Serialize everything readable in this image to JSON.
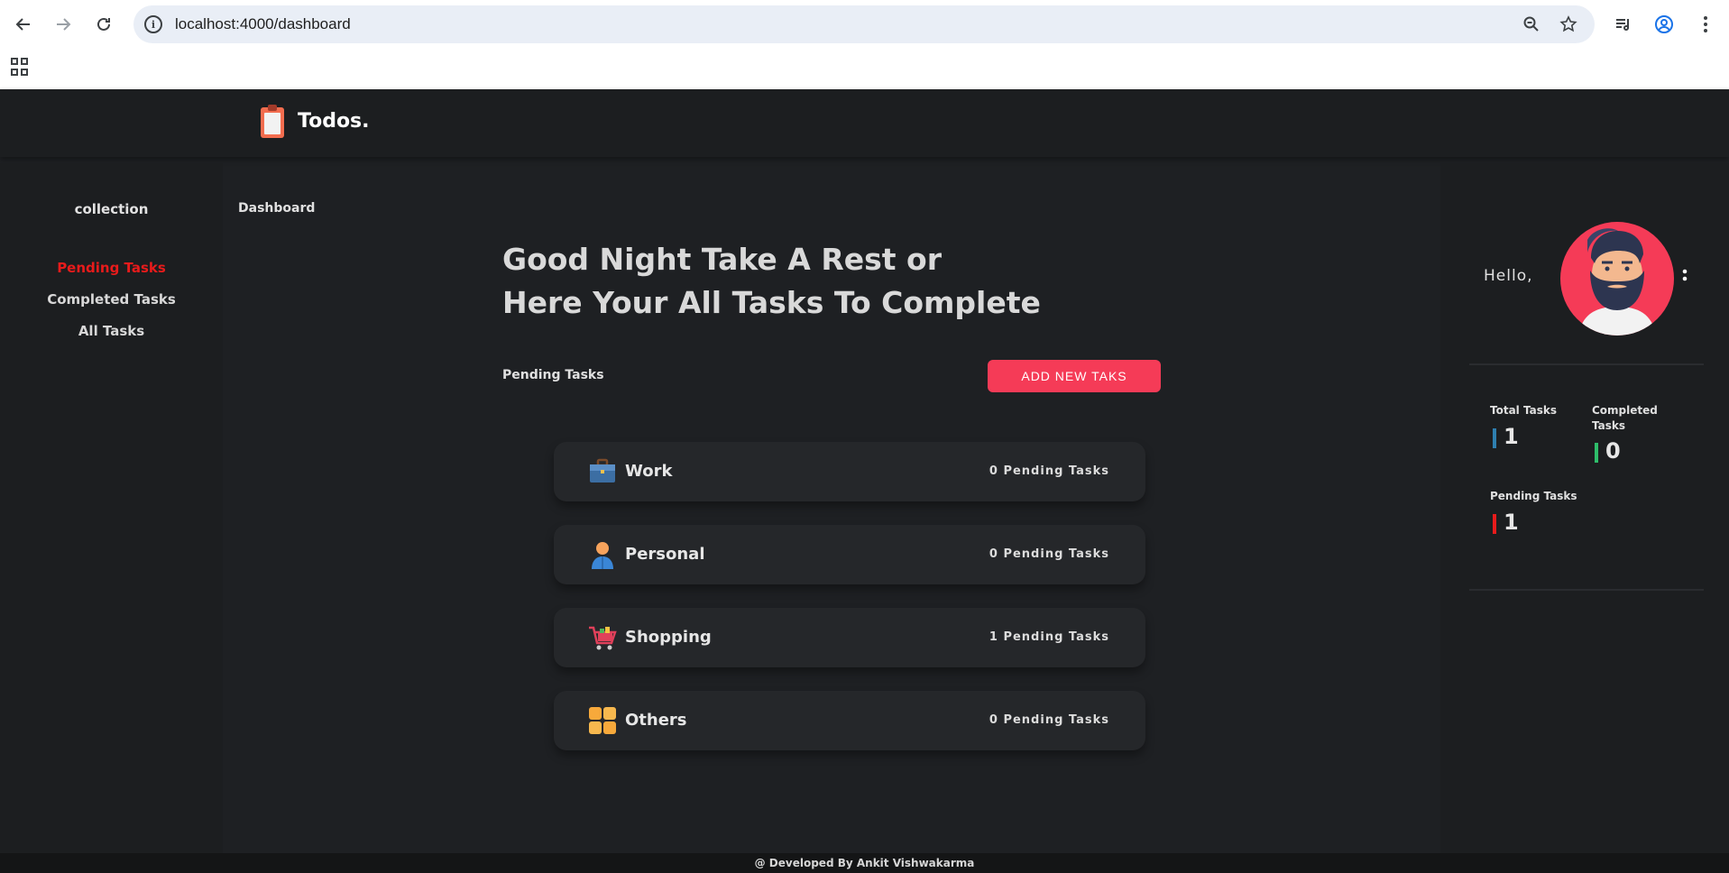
{
  "browser": {
    "url": "localhost:4000/dashboard",
    "back_icon": "arrow-left-icon",
    "forward_icon": "arrow-right-icon",
    "reload_icon": "reload-icon",
    "site_info_icon": "info-icon",
    "zoom_icon": "zoom-icon",
    "bookmark_icon": "star-icon",
    "reading_list_icon": "media-icon",
    "profile_icon": "profile-icon",
    "menu_icon": "kebab-icon",
    "apps_icon": "apps-grid-icon"
  },
  "header": {
    "brand": "Todos.",
    "logo_icon": "clipboard-icon"
  },
  "sidebar": {
    "title": "collection",
    "items": [
      {
        "label": "Pending Tasks",
        "active": true
      },
      {
        "label": "Completed Tasks",
        "active": false
      },
      {
        "label": "All Tasks",
        "active": false
      }
    ]
  },
  "main": {
    "breadcrumb": "Dashboard",
    "greeting_line1": "Good Night Take A Rest or",
    "greeting_line2": "Here Your All Tasks To Complete",
    "section_label": "Pending Tasks",
    "add_button": "ADD NEW TAKS",
    "categories": [
      {
        "name": "Work",
        "count_label": "0 Pending Tasks",
        "icon": "briefcase-icon"
      },
      {
        "name": "Personal",
        "count_label": "0 Pending Tasks",
        "icon": "person-icon"
      },
      {
        "name": "Shopping",
        "count_label": "1 Pending Tasks",
        "icon": "shopping-cart-icon"
      },
      {
        "name": "Others",
        "count_label": "0 Pending Tasks",
        "icon": "grid-icon"
      }
    ]
  },
  "profile": {
    "hello": "Hello,",
    "avatar_icon": "bearded-man-avatar",
    "menu_icon": "vertical-dots-icon",
    "stats": {
      "total_label": "Total Tasks",
      "total_value": "1",
      "completed_label": "Completed Tasks",
      "completed_value": "0",
      "pending_label": "Pending Tasks",
      "pending_value": "1"
    }
  },
  "colors": {
    "accent": "#f53b57",
    "active_nav": "#e81b1b",
    "total_bar": "#2e7fb0",
    "completed_bar": "#2ebd6a",
    "pending_bar": "#e81b1b",
    "background": "#1e2023",
    "panel": "#1c1e20",
    "card": "#25272a"
  },
  "footer": {
    "text": "@ Developed By Ankit Vishwakarma"
  }
}
